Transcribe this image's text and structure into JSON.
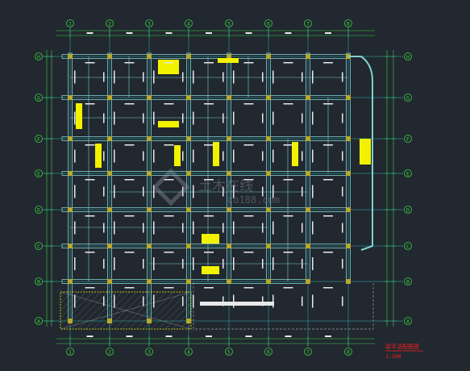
{
  "drawing": {
    "colors": {
      "background": "#212830",
      "dimension_line": "#3ecf3e",
      "axis_line": "#2fb8b8",
      "beam": "#7fd0d0",
      "column": "#b8a830",
      "text_white": "#e8e8e8",
      "note_yellow": "#f2f200",
      "title_red": "#ff2020",
      "hatch": "#b0b0b0",
      "dashed_boundary": "#9a9a9a"
    },
    "axes": {
      "columns": [
        "1",
        "2",
        "3",
        "4",
        "5",
        "6",
        "7",
        "8"
      ],
      "rows": [
        "H",
        "G",
        "F",
        "E",
        "D",
        "C",
        "B",
        "A"
      ]
    },
    "title": {
      "line1": "梁平法配筋图",
      "line2": "1:100"
    },
    "watermark": {
      "brand": "土木在线",
      "url": "co188.com"
    }
  }
}
